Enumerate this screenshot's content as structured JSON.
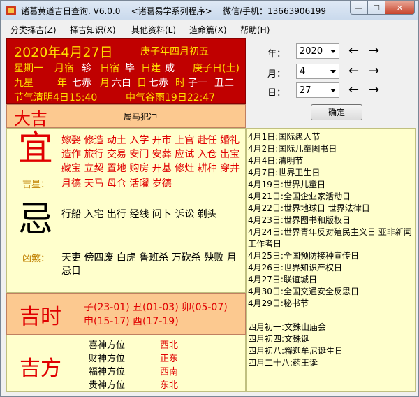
{
  "window": {
    "title": "诸葛黄道吉日查询. V6.0.0    <诸葛易学系列程序>    微信/手机：13663906199",
    "min_glyph": "—",
    "max_glyph": "☐",
    "close_glyph": "✕"
  },
  "menu": {
    "items": [
      "分类择吉(Z)",
      "择吉知识(X)",
      "其他资料(L)",
      "造命篇(X)",
      "帮助(H)"
    ]
  },
  "header": {
    "solar_date": "2020年4月27日",
    "lunar_date": "庚子年四月初五",
    "row2": [
      "星期一",
      "月宿",
      "轸",
      "日宿",
      "毕",
      "日建",
      "成",
      "庚子日(土)"
    ],
    "row3": [
      "九星",
      "年",
      "七赤",
      "月",
      "六白",
      "日",
      "七赤",
      "时",
      "子一",
      "丑二"
    ],
    "solar_term_1": "节气清明4日15:40",
    "solar_term_2": "中气谷雨19日22:47"
  },
  "date_picker": {
    "year_label": "年：",
    "year_value": "2020",
    "month_label": "月：",
    "month_value": "4",
    "day_label": "日：",
    "day_value": "27",
    "left_arrow": "←",
    "right_arrow": "→",
    "confirm_label": "确定"
  },
  "fortune": {
    "title": "大吉",
    "conflict": "属马犯冲"
  },
  "yi": {
    "char": "宜",
    "line1": "嫁娶 修造 动土 入学 开市 上官 赴任 婚礼",
    "line2": "造作 旅行 交易 安门 安葬 应试 入仓 出宝",
    "line3": "藏宝 立契 置地 购房 开基 修灶 耕种 穿井",
    "good_star_label": "吉星：",
    "good_stars": "月德 天马 母仓 活曜 岁德"
  },
  "ji": {
    "char": "忌",
    "items": "行船 入宅 出行 经线 问卜 诉讼 剃头",
    "bad_star_label": "凶煞：",
    "bad_stars_line1": "天吏 傍四废 白虎 鲁班杀 万砍杀 殃败 月",
    "bad_stars_line2": "忌日"
  },
  "lucky_hours": {
    "title": "吉时",
    "line1": "子(23-01) 丑(01-03) 卯(05-07)",
    "line2": "申(15-17) 酉(17-19)"
  },
  "lucky_directions": {
    "title": "吉方",
    "rows": [
      {
        "label": "喜神方位",
        "value": "西北"
      },
      {
        "label": "财神方位",
        "value": "正东"
      },
      {
        "label": "福神方位",
        "value": "西南"
      },
      {
        "label": "贵神方位",
        "value": "东北"
      }
    ]
  },
  "festivals": [
    "4月1日:国际愚人节",
    "4月2日:国际儿童图书日",
    "4月4日:清明节",
    "4月7日:世界卫生日",
    "4月19日:世界儿童日",
    "4月21日:全国企业家活动日",
    "4月22日:世界地球日 世界法律日",
    "4月23日:世界图书和版权日",
    "4月24日:世界青年反对殖民主义日 亚非新闻",
    "工作者日",
    "4月25日:全国预防接种宣传日",
    "4月26日:世界知识产权日",
    "4月27日:联谊城日",
    "4月30日:全国交通安全反思日",
    "4月29日:秘书节",
    "",
    "四月初一:文殊山庙会",
    "四月初四:文殊诞",
    "四月初八:释迦牟尼诞生日",
    "四月二十八:药王诞"
  ],
  "colors": {
    "header_bg": "#c00000",
    "header_text_yellow": "#ffde00",
    "fortune_bg": "#fcc990",
    "panel_bg": "#ffffcc",
    "accent_red": "#e00000"
  }
}
